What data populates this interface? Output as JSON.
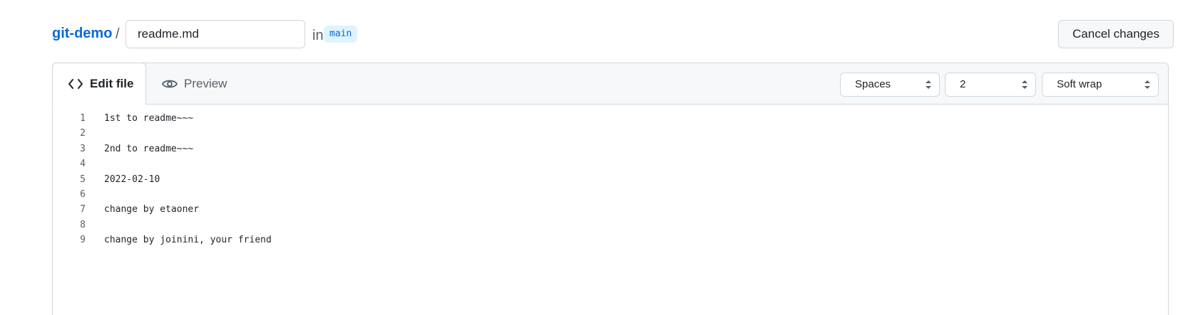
{
  "header": {
    "repo_name": "git-demo",
    "separator": "/",
    "filename_value": "readme.md",
    "in_text": "in",
    "branch": "main",
    "cancel_label": "Cancel changes"
  },
  "tabs": {
    "edit_label": "Edit file",
    "preview_label": "Preview"
  },
  "options": {
    "indent_mode": "Spaces",
    "indent_size": "2",
    "wrap_mode": "Soft wrap"
  },
  "code_lines": [
    {
      "num": "1",
      "text": "1st to readme~~~"
    },
    {
      "num": "2",
      "text": ""
    },
    {
      "num": "3",
      "text": "2nd to readme~~~"
    },
    {
      "num": "4",
      "text": ""
    },
    {
      "num": "5",
      "text": "2022-02-10"
    },
    {
      "num": "6",
      "text": ""
    },
    {
      "num": "7",
      "text": "change by etaoner"
    },
    {
      "num": "8",
      "text": ""
    },
    {
      "num": "9",
      "text": "change by joinini, your friend"
    }
  ],
  "colors": {
    "link": "#0969da",
    "badge_bg": "#ddf4ff",
    "border": "#d0d7de",
    "header_bg": "#f6f8fa"
  },
  "icons": {
    "edit_tab": "code-icon",
    "preview_tab": "eye-icon",
    "select_caret": "select-caret-icon"
  }
}
